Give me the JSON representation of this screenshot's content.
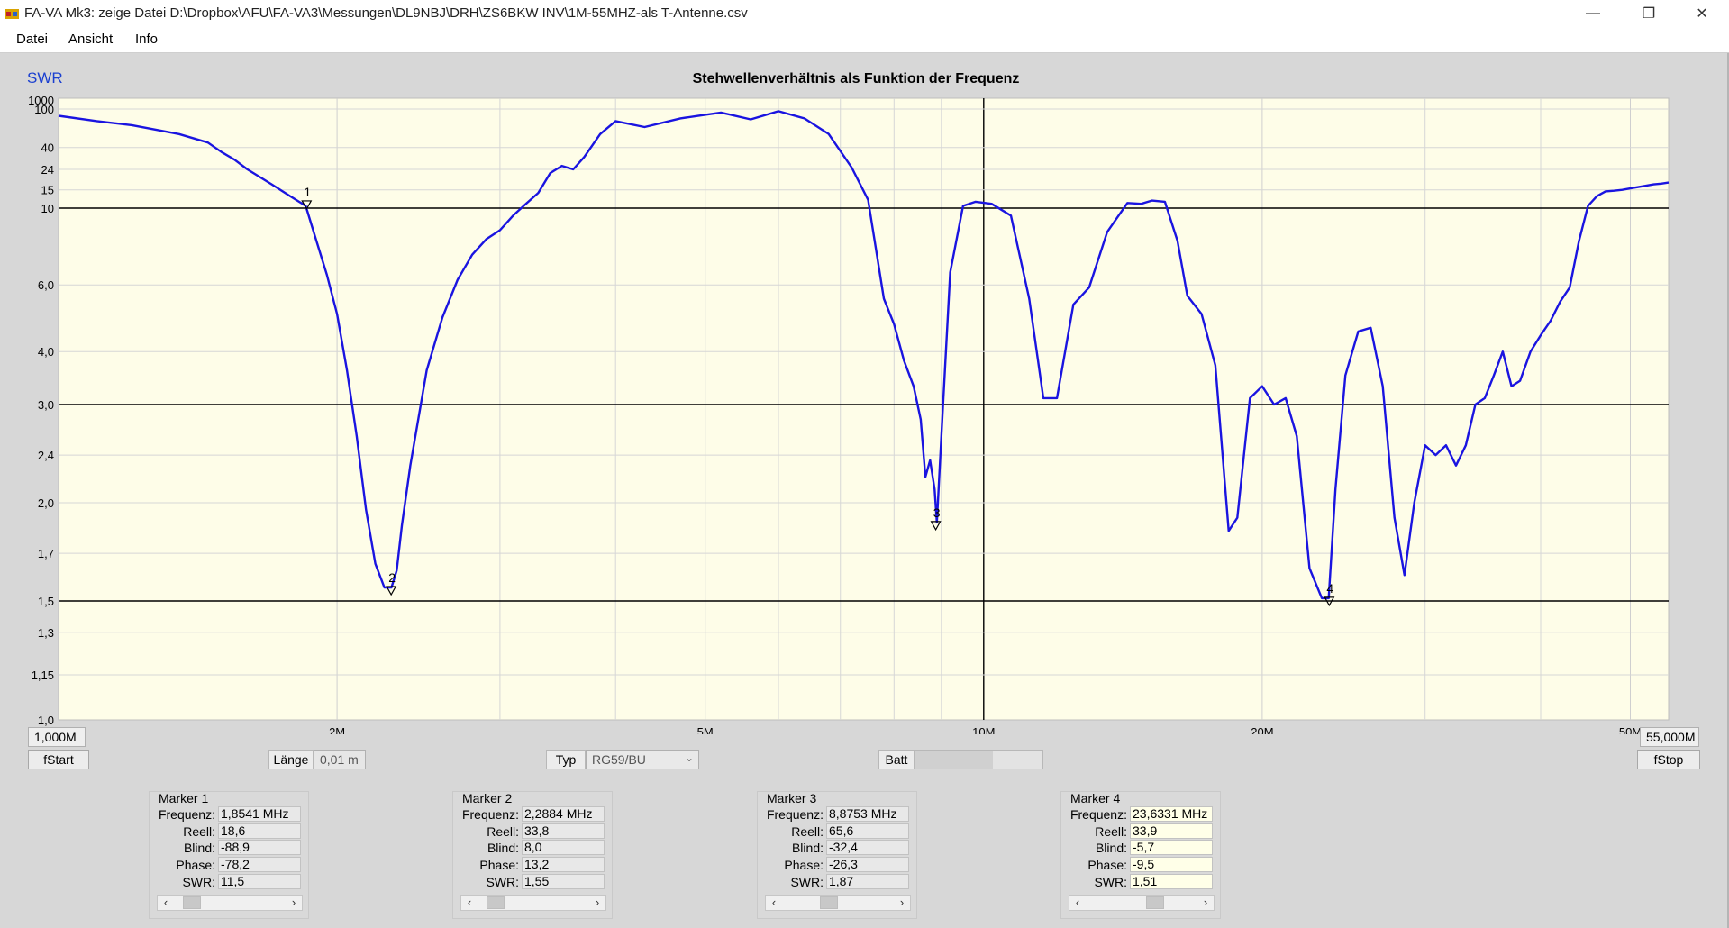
{
  "window": {
    "title": "FA-VA Mk3:  zeige Datei  D:\\Dropbox\\AFU\\FA-VA3\\Messungen\\DL9NBJ\\DRH\\ZS6BKW INV\\1M-55MHZ-als T-Antenne.csv",
    "minimize": "—",
    "restore": "❐",
    "close": "✕"
  },
  "menu": {
    "items": [
      "Datei",
      "Ansicht",
      "Info"
    ]
  },
  "chart_data": {
    "type": "line",
    "title": "Stehwellenverhältnis als Funktion der Frequenz",
    "ylabel": "SWR",
    "xlabel": "",
    "x_scale": "log",
    "y_scale": "log(SWR-1)",
    "xlim": [
      1.0,
      55.0
    ],
    "ylim": [
      1.0,
      1000
    ],
    "grid": true,
    "x_ticks": [
      {
        "value": 2,
        "label": "2M"
      },
      {
        "value": 5,
        "label": "5M"
      },
      {
        "value": 10,
        "label": "10M"
      },
      {
        "value": 20,
        "label": "20M"
      },
      {
        "value": 50,
        "label": "50M"
      }
    ],
    "x_minor": [
      3,
      4,
      6,
      7,
      8,
      9,
      30,
      40
    ],
    "x_major_lines": [
      10
    ],
    "y_ticks": [
      {
        "value": 1000,
        "label": "1000"
      },
      {
        "value": 100,
        "label": "100"
      },
      {
        "value": 40,
        "label": "40"
      },
      {
        "value": 24,
        "label": "24"
      },
      {
        "value": 15,
        "label": "15"
      },
      {
        "value": 10,
        "label": "10"
      },
      {
        "value": 6.0,
        "label": "6,0"
      },
      {
        "value": 4.0,
        "label": "4,0"
      },
      {
        "value": 3.0,
        "label": "3,0"
      },
      {
        "value": 2.4,
        "label": "2,4"
      },
      {
        "value": 2.0,
        "label": "2,0"
      },
      {
        "value": 1.7,
        "label": "1,7"
      },
      {
        "value": 1.5,
        "label": "1,5"
      },
      {
        "value": 1.3,
        "label": "1,3"
      },
      {
        "value": 1.15,
        "label": "1,15"
      },
      {
        "value": 1.0,
        "label": "1,0"
      }
    ],
    "y_major_lines": [
      10,
      3.0,
      1.5
    ],
    "series": [
      {
        "color": "#1a14e0",
        "x": [
          1.0,
          1.1,
          1.2,
          1.35,
          1.45,
          1.5,
          1.55,
          1.6,
          1.7,
          1.78,
          1.85,
          1.9,
          1.95,
          2.0,
          2.05,
          2.1,
          2.15,
          2.2,
          2.25,
          2.29,
          2.32,
          2.35,
          2.4,
          2.5,
          2.6,
          2.7,
          2.8,
          2.9,
          3.0,
          3.1,
          3.2,
          3.3,
          3.4,
          3.5,
          3.6,
          3.7,
          3.85,
          4.0,
          4.3,
          4.7,
          5.2,
          5.6,
          6.0,
          6.4,
          6.8,
          7.2,
          7.5,
          7.8,
          8.0,
          8.2,
          8.4,
          8.55,
          8.65,
          8.75,
          8.85,
          8.9,
          9.0,
          9.2,
          9.5,
          9.8,
          10.2,
          10.7,
          11.2,
          11.6,
          12.0,
          12.5,
          13.0,
          13.6,
          14.3,
          14.8,
          15.2,
          15.7,
          16.2,
          16.6,
          17.2,
          17.8,
          18.4,
          18.8,
          19.4,
          20.0,
          20.6,
          21.2,
          21.8,
          22.5,
          23.2,
          23.6,
          24.0,
          24.6,
          25.4,
          26.2,
          27.0,
          27.8,
          28.5,
          29.2,
          30.0,
          30.8,
          31.6,
          32.4,
          33.2,
          34.0,
          34.8,
          35.6,
          36.4,
          37.2,
          38.0,
          39.0,
          40.0,
          41.0,
          42.0,
          43.0,
          44.0,
          45.0,
          46.0,
          47.0,
          48.0,
          49.0,
          50.0,
          51.0,
          52.0,
          53.0,
          54.0,
          55.0
        ],
        "values": [
          85,
          75,
          68,
          55,
          45,
          36,
          30,
          24,
          17,
          13,
          10.5,
          8.0,
          6.4,
          5.0,
          3.6,
          2.6,
          1.95,
          1.65,
          1.55,
          1.55,
          1.62,
          1.85,
          2.3,
          3.6,
          4.9,
          6.2,
          7.3,
          8.1,
          8.6,
          9.5,
          11,
          14,
          22,
          26,
          24,
          32,
          55,
          75,
          65,
          80,
          92,
          78,
          95,
          80,
          55,
          25,
          12,
          5.5,
          4.7,
          3.8,
          3.3,
          2.8,
          2.2,
          2.35,
          2.1,
          1.87,
          2.6,
          6.5,
          10.5,
          11.5,
          11.0,
          9.5,
          5.5,
          3.1,
          3.1,
          5.3,
          5.9,
          8.5,
          11.2,
          11.0,
          11.8,
          11.5,
          8.0,
          5.6,
          5.0,
          3.7,
          1.82,
          1.9,
          3.1,
          3.3,
          3.0,
          3.1,
          2.6,
          1.63,
          1.51,
          1.51,
          2.1,
          3.5,
          4.5,
          4.6,
          3.3,
          1.9,
          1.6,
          2.0,
          2.5,
          2.4,
          2.5,
          2.3,
          2.5,
          3.0,
          3.1,
          3.5,
          4.0,
          3.3,
          3.4,
          4.0,
          4.4,
          4.8,
          5.4,
          5.9,
          8.0,
          10.5,
          13.0,
          14.5,
          14.7,
          15.0,
          15.5,
          16.0,
          16.5,
          17.0,
          17.3,
          17.7
        ]
      }
    ],
    "markers": [
      {
        "label": "1",
        "x": 1.8541,
        "swr": 11.5
      },
      {
        "label": "2",
        "x": 2.2884,
        "swr": 1.55
      },
      {
        "label": "3",
        "x": 8.8753,
        "swr": 1.87
      },
      {
        "label": "4",
        "x": 23.6331,
        "swr": 1.51
      }
    ]
  },
  "controls": {
    "fstart_value": "1,000M",
    "fstart_label": "fStart",
    "fstop_value": "55,000M",
    "fstop_label": "fStop",
    "laenge_label": "Länge",
    "laenge_value": "0,01 m",
    "typ_label": "Typ",
    "typ_value": "RG59/BU",
    "batt_label": "Batt"
  },
  "marker_panels": [
    {
      "title": "Marker 1",
      "rows": [
        {
          "label": "Frequenz:",
          "value": "1,8541 MHz"
        },
        {
          "label": "Reell:",
          "value": "18,6"
        },
        {
          "label": "Blind:",
          "value": "-88,9"
        },
        {
          "label": "Phase:",
          "value": "-78,2"
        },
        {
          "label": "SWR:",
          "value": "11,5"
        }
      ]
    },
    {
      "title": "Marker 2",
      "rows": [
        {
          "label": "Frequenz:",
          "value": "2,2884 MHz"
        },
        {
          "label": "Reell:",
          "value": "33,8"
        },
        {
          "label": "Blind:",
          "value": "8,0"
        },
        {
          "label": "Phase:",
          "value": "13,2"
        },
        {
          "label": "SWR:",
          "value": "1,55"
        }
      ]
    },
    {
      "title": "Marker 3",
      "rows": [
        {
          "label": "Frequenz:",
          "value": "8,8753 MHz"
        },
        {
          "label": "Reell:",
          "value": "65,6"
        },
        {
          "label": "Blind:",
          "value": "-32,4"
        },
        {
          "label": "Phase:",
          "value": "-26,3"
        },
        {
          "label": "SWR:",
          "value": "1,87"
        }
      ]
    },
    {
      "title": "Marker 4",
      "rows": [
        {
          "label": "Frequenz:",
          "value": "23,6331 MHz"
        },
        {
          "label": "Reell:",
          "value": "33,9"
        },
        {
          "label": "Blind:",
          "value": "-5,7"
        },
        {
          "label": "Phase:",
          "value": "-9,5"
        },
        {
          "label": "SWR:",
          "value": "1,51"
        }
      ]
    }
  ],
  "colors": {
    "plot_bg": "#fefde8",
    "curve": "#1a14e0",
    "swr_label": "#1a3fd0"
  }
}
